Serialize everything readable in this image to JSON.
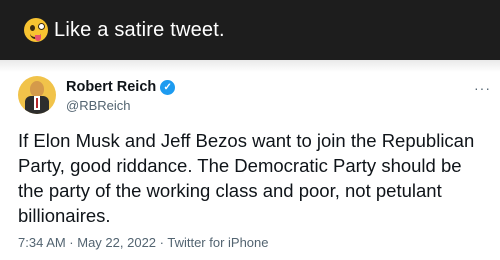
{
  "banner": {
    "text": "Like a satire tweet.",
    "emoji": "zany-face"
  },
  "tweet": {
    "author_name": "Robert Reich",
    "handle": "@RBReich",
    "verified_icon": "verified-check-icon",
    "body": "If Elon Musk and Jeff Bezos want to join the Republican Party, good riddance. The Democratic Party should be the party of the working class and poor, not petulant billionaires.",
    "timestamp": "7:34 AM · May 22, 2022 · Twitter for iPhone",
    "more_label": "···"
  },
  "colors": {
    "banner_bg": "#1d1d1d",
    "verified": "#1d9bf0",
    "text_primary": "#0f1419",
    "text_secondary": "#536471"
  }
}
